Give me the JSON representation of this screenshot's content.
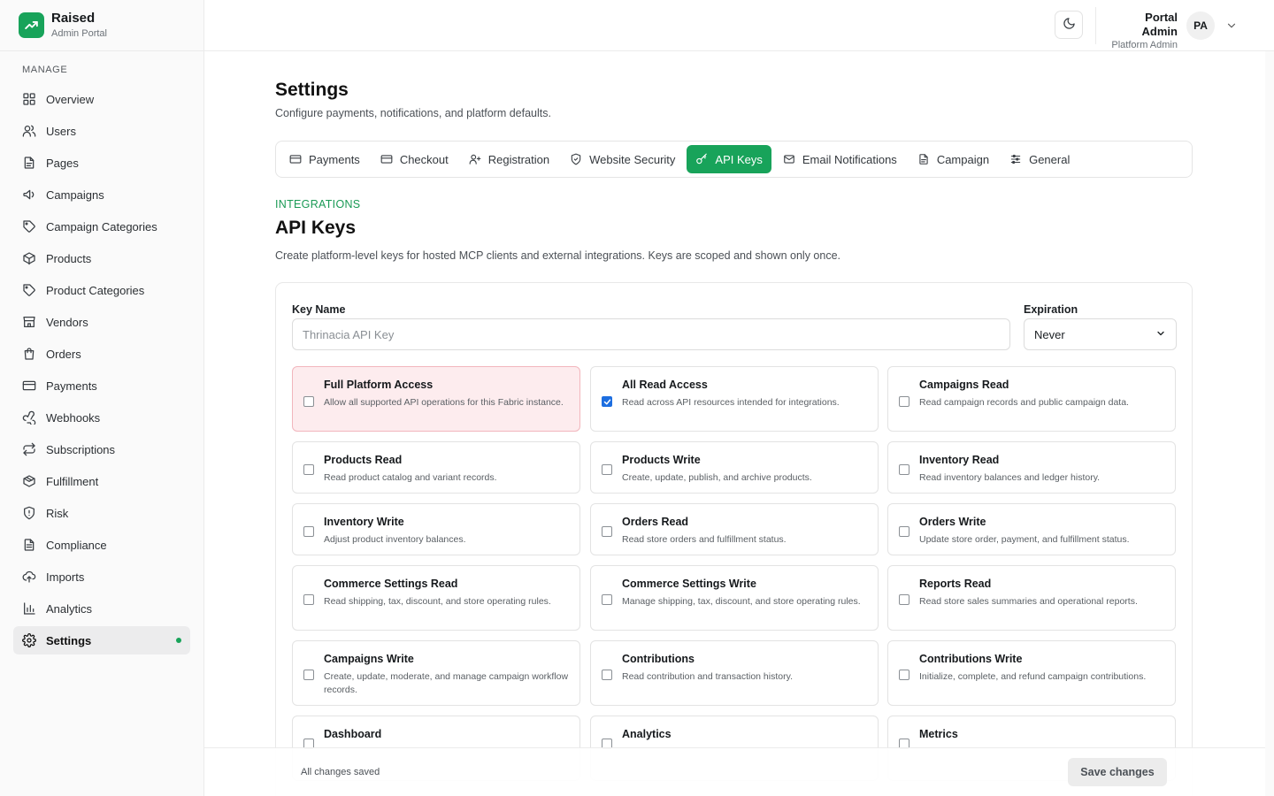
{
  "brand": {
    "name": "Raised",
    "subtitle": "Admin Portal",
    "accent": "#18a35a"
  },
  "sidebar": {
    "section_label": "MANAGE",
    "items": [
      {
        "label": "Overview",
        "icon": "grid-icon"
      },
      {
        "label": "Users",
        "icon": "users-icon"
      },
      {
        "label": "Pages",
        "icon": "file-icon"
      },
      {
        "label": "Campaigns",
        "icon": "megaphone-icon"
      },
      {
        "label": "Campaign Categories",
        "icon": "tag-icon"
      },
      {
        "label": "Products",
        "icon": "package-icon"
      },
      {
        "label": "Product Categories",
        "icon": "tag-icon"
      },
      {
        "label": "Vendors",
        "icon": "store-icon"
      },
      {
        "label": "Orders",
        "icon": "shopping-bag-icon"
      },
      {
        "label": "Payments",
        "icon": "credit-card-icon"
      },
      {
        "label": "Webhooks",
        "icon": "webhook-icon"
      },
      {
        "label": "Subscriptions",
        "icon": "repeat-icon"
      },
      {
        "label": "Fulfillment",
        "icon": "box-icon"
      },
      {
        "label": "Risk",
        "icon": "shield-alert-icon"
      },
      {
        "label": "Compliance",
        "icon": "file-text-icon"
      },
      {
        "label": "Imports",
        "icon": "cloud-upload-icon"
      },
      {
        "label": "Analytics",
        "icon": "bar-chart-icon"
      },
      {
        "label": "Settings",
        "icon": "gear-icon",
        "active": true
      }
    ]
  },
  "header": {
    "theme_toggle_icon": "moon-icon",
    "user_name": "Portal Admin",
    "user_role": "Platform Admin",
    "avatar_initials": "PA"
  },
  "page": {
    "title": "Settings",
    "subtitle": "Configure payments, notifications, and platform defaults."
  },
  "tabs": [
    {
      "label": "Payments",
      "icon": "credit-card-icon"
    },
    {
      "label": "Checkout",
      "icon": "credit-card-icon"
    },
    {
      "label": "Registration",
      "icon": "user-plus-icon"
    },
    {
      "label": "Website Security",
      "icon": "shield-icon"
    },
    {
      "label": "API Keys",
      "icon": "key-icon",
      "active": true
    },
    {
      "label": "Email Notifications",
      "icon": "mail-icon"
    },
    {
      "label": "Campaign",
      "icon": "file-icon"
    },
    {
      "label": "General",
      "icon": "sliders-icon"
    }
  ],
  "api_keys": {
    "eyebrow": "INTEGRATIONS",
    "title": "API Keys",
    "description": "Create platform-level keys for hosted MCP clients and external integrations. Keys are scoped and shown only once.",
    "key_name_label": "Key Name",
    "key_name_placeholder": "Thrinacia API Key",
    "key_name_value": "",
    "expiration_label": "Expiration",
    "expiration_value": "Never",
    "scopes": [
      {
        "title": "Full Platform Access",
        "desc": "Allow all supported API operations for this Fabric instance.",
        "checked": false,
        "danger": true
      },
      {
        "title": "All Read Access",
        "desc": "Read across API resources intended for integrations.",
        "checked": true
      },
      {
        "title": "Campaigns Read",
        "desc": "Read campaign records and public campaign data.",
        "checked": false
      },
      {
        "title": "Products Read",
        "desc": "Read product catalog and variant records.",
        "checked": false
      },
      {
        "title": "Products Write",
        "desc": "Create, update, publish, and archive products.",
        "checked": false
      },
      {
        "title": "Inventory Read",
        "desc": "Read inventory balances and ledger history.",
        "checked": false
      },
      {
        "title": "Inventory Write",
        "desc": "Adjust product inventory balances.",
        "checked": false
      },
      {
        "title": "Orders Read",
        "desc": "Read store orders and fulfillment status.",
        "checked": false
      },
      {
        "title": "Orders Write",
        "desc": "Update store order, payment, and fulfillment status.",
        "checked": false
      },
      {
        "title": "Commerce Settings Read",
        "desc": "Read shipping, tax, discount, and store operating rules.",
        "checked": false
      },
      {
        "title": "Commerce Settings Write",
        "desc": "Manage shipping, tax, discount, and store operating rules.",
        "checked": false
      },
      {
        "title": "Reports Read",
        "desc": "Read store sales summaries and operational reports.",
        "checked": false
      },
      {
        "title": "Campaigns Write",
        "desc": "Create, update, moderate, and manage campaign workflow records.",
        "checked": false
      },
      {
        "title": "Contributions",
        "desc": "Read contribution and transaction history.",
        "checked": false
      },
      {
        "title": "Contributions Write",
        "desc": "Initialize, complete, and refund campaign contributions.",
        "checked": false
      },
      {
        "title": "Dashboard",
        "desc": "",
        "checked": false
      },
      {
        "title": "Analytics",
        "desc": "",
        "checked": false
      },
      {
        "title": "Metrics",
        "desc": "",
        "checked": false
      }
    ]
  },
  "footer": {
    "status": "All changes saved",
    "save_label": "Save changes"
  }
}
